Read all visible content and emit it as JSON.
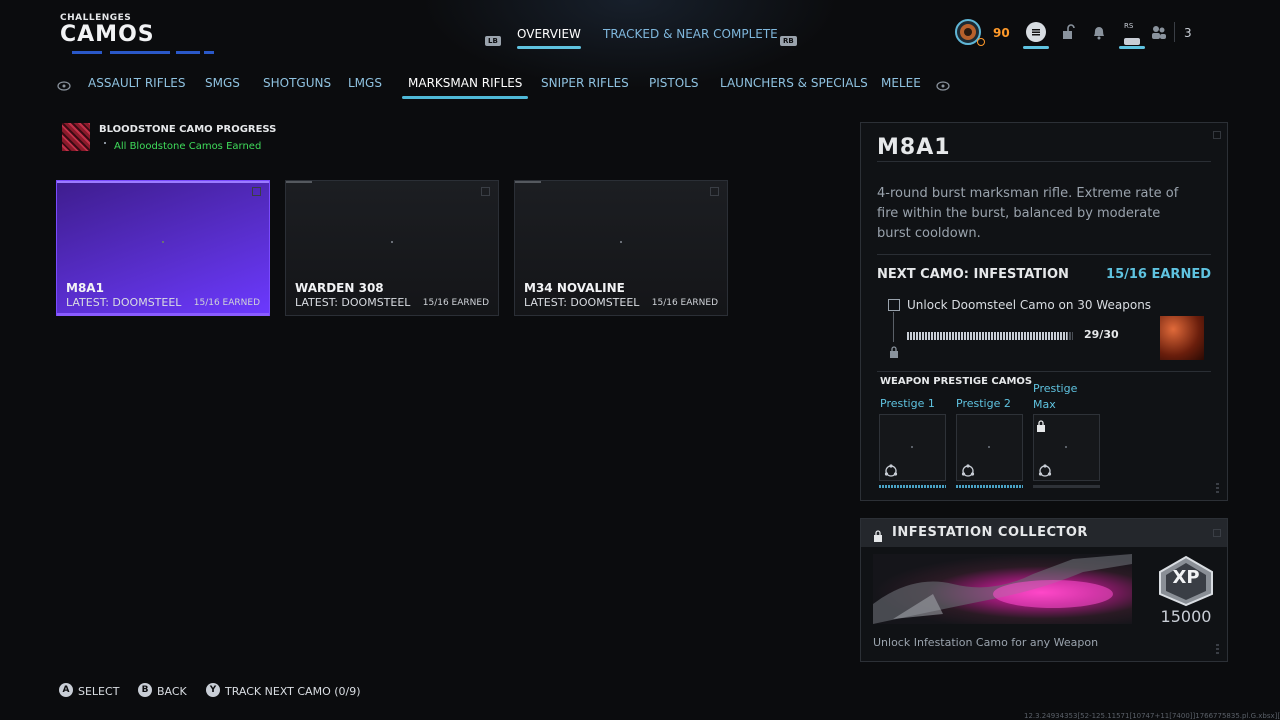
{
  "header": {
    "section": "CHALLENGES",
    "title": "CAMOS",
    "lb": "LB",
    "rb": "RB",
    "tabs": [
      {
        "label": "OVERVIEW",
        "active": true
      },
      {
        "label": "TRACKED & NEAR COMPLETE",
        "active": false
      }
    ],
    "currency": "90",
    "rs": "RS",
    "party_count": "3"
  },
  "categories": [
    {
      "label": "ASSAULT RIFLES"
    },
    {
      "label": "SMGS"
    },
    {
      "label": "SHOTGUNS"
    },
    {
      "label": "LMGS"
    },
    {
      "label": "MARKSMAN RIFLES",
      "active": true
    },
    {
      "label": "SNIPER RIFLES"
    },
    {
      "label": "PISTOLS"
    },
    {
      "label": "LAUNCHERS & SPECIALS"
    },
    {
      "label": "MELEE"
    }
  ],
  "bloodstone": {
    "title": "BLOODSTONE CAMO PROGRESS",
    "status": "All Bloodstone Camos Earned",
    "status_color": "#3fdc5b"
  },
  "weapons": [
    {
      "name": "M8A1",
      "latest": "LATEST: DOOMSTEEL",
      "earned": "15/16 EARNED",
      "selected": true
    },
    {
      "name": "WARDEN 308",
      "latest": "LATEST: DOOMSTEEL",
      "earned": "15/16 EARNED",
      "selected": false
    },
    {
      "name": "M34 NOVALINE",
      "latest": "LATEST: DOOMSTEEL",
      "earned": "15/16 EARNED",
      "selected": false
    }
  ],
  "detail": {
    "name": "M8A1",
    "description": "4-round burst marksman rifle. Extreme rate of fire within the burst, balanced by moderate burst cooldown.",
    "next_camo_label": "NEXT CAMO: INFESTATION",
    "next_camo_earned": "15/16 EARNED",
    "challenge": "Unlock Doomsteel Camo on 30 Weapons",
    "progress_text": "29/30",
    "progress_fraction": 0.967,
    "prestige_heading": "WEAPON PRESTIGE CAMOS",
    "prestige": [
      {
        "label": "Prestige 1",
        "locked": false
      },
      {
        "label": "Prestige 2",
        "locked": false
      },
      {
        "label": "Prestige Max",
        "locked": true
      }
    ]
  },
  "collector": {
    "title": "INFESTATION COLLECTOR",
    "xp_label": "XP",
    "xp_value": "15000",
    "description": "Unlock Infestation Camo for any Weapon"
  },
  "footer": {
    "buttons": [
      {
        "key": "A",
        "label": "SELECT"
      },
      {
        "key": "B",
        "label": "BACK"
      },
      {
        "key": "Y",
        "label": "TRACK NEXT CAMO (0/9)"
      }
    ],
    "build_info": "12.3.24934353[52-125.11571[10747+11[7400]]1766775835.pl.G.xbsx][000122b1000"
  },
  "colors": {
    "accent_blue": "#5fc3e0",
    "accent_purple": "#6c39ff",
    "currency_orange": "#ff9a2a"
  }
}
